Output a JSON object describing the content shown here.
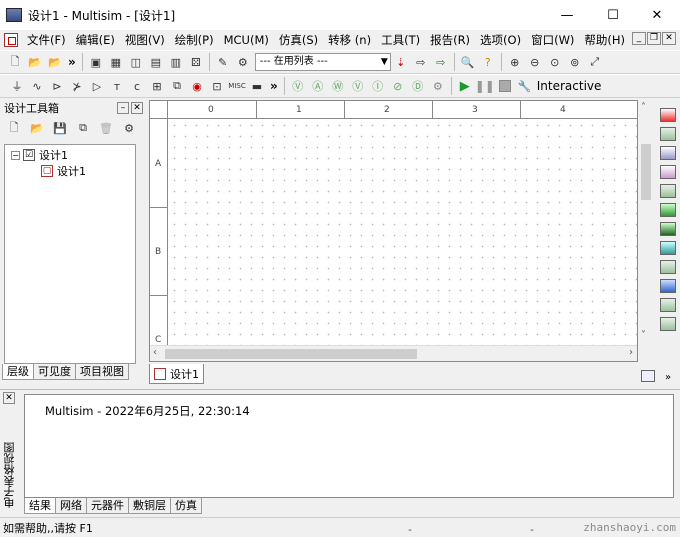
{
  "window": {
    "title": "设计1 - Multisim - [设计1]"
  },
  "menu": {
    "items": [
      {
        "id": "file",
        "label": "文件(F)"
      },
      {
        "id": "edit",
        "label": "编辑(E)"
      },
      {
        "id": "view",
        "label": "视图(V)"
      },
      {
        "id": "place",
        "label": "绘制(P)"
      },
      {
        "id": "mcu",
        "label": "MCU(M)"
      },
      {
        "id": "simulate",
        "label": "仿真(S)"
      },
      {
        "id": "transfer",
        "label": "转移 (n)"
      },
      {
        "id": "tools",
        "label": "工具(T)"
      },
      {
        "id": "reports",
        "label": "报告(R)"
      },
      {
        "id": "options",
        "label": "选项(O)"
      },
      {
        "id": "window",
        "label": "窗口(W)"
      },
      {
        "id": "help",
        "label": "帮助(H)"
      }
    ]
  },
  "toolbar": {
    "in_use_list": "--- 在用列表 ---",
    "interactive_label": "Interactive",
    "more_glyph": "»",
    "misc_label": "MISC"
  },
  "ruler": {
    "columns": [
      "0",
      "1",
      "2",
      "3",
      "4"
    ],
    "rows": [
      "A",
      "B",
      "C"
    ]
  },
  "design_toolbox": {
    "title": "设计工具箱",
    "tree": {
      "root": "设计1",
      "child": "设计1"
    },
    "tabs": [
      {
        "label": "层级",
        "active": true
      },
      {
        "label": "可见度",
        "active": false
      },
      {
        "label": "项目视图",
        "active": false
      }
    ]
  },
  "document_tabs": [
    {
      "label": "设计1",
      "active": true
    }
  ],
  "spreadsheet": {
    "title": "电子表格视图",
    "output_line": "Multisim  -  2022年6月25日, 22:30:14",
    "tabs": [
      {
        "label": "结果",
        "active": true
      },
      {
        "label": "网络",
        "active": false
      },
      {
        "label": "元器件",
        "active": false
      },
      {
        "label": "敷铜层",
        "active": false
      },
      {
        "label": "仿真",
        "active": false
      }
    ]
  },
  "status": {
    "help_text": "如需帮助,,请按 F1",
    "separator": "-"
  },
  "watermark": "zhanshaoyi.com"
}
